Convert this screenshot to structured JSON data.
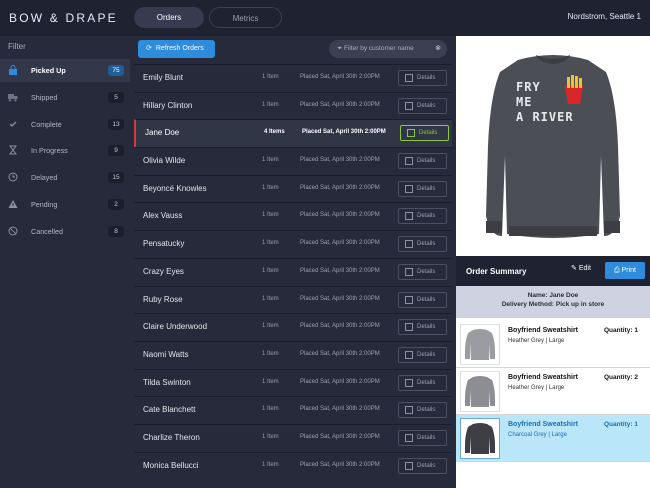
{
  "header": {
    "logo": "BOW & DRAPE",
    "tabs": [
      {
        "label": "Orders",
        "active": true
      },
      {
        "label": "Metrics",
        "active": false
      }
    ],
    "store": "Nordstrom, Seattle 1"
  },
  "sidebar": {
    "heading": "Filter",
    "items": [
      {
        "label": "Picked Up",
        "count": "75",
        "icon": "bag-icon",
        "active": true
      },
      {
        "label": "Shipped",
        "count": "5",
        "icon": "truck-icon",
        "active": false
      },
      {
        "label": "Complete",
        "count": "13",
        "icon": "check-icon",
        "active": false
      },
      {
        "label": "In Progress",
        "count": "9",
        "icon": "hourglass-icon",
        "active": false
      },
      {
        "label": "Delayed",
        "count": "15",
        "icon": "clock-icon",
        "active": false
      },
      {
        "label": "Pending",
        "count": "2",
        "icon": "warning-icon",
        "active": false
      },
      {
        "label": "Cancelled",
        "count": "8",
        "icon": "ban-icon",
        "active": false
      }
    ]
  },
  "toolbar": {
    "refresh_label": "Refresh Orders",
    "filter_placeholder": "Filter by customer name"
  },
  "orders": [
    {
      "name": "Emily Blunt",
      "items": "1 Item",
      "placed": "Placed Sat, April 30th 2:00PM",
      "details": "Details"
    },
    {
      "name": "Hillary Clinton",
      "items": "1 Item",
      "placed": "Placed Sat, April 30th 2:00PM",
      "details": "Details"
    },
    {
      "name": "Jane Doe",
      "items": "4 Items",
      "placed": "Placed Sat, April 30th 2:00PM",
      "details": "Details",
      "selected": true
    },
    {
      "name": "Olivia Wilde",
      "items": "1 Item",
      "placed": "Placed Sat, April 30th 2:00PM",
      "details": "Details"
    },
    {
      "name": "Beyoncé Knowles",
      "items": "1 Item",
      "placed": "Placed Sat, April 30th 2:00PM",
      "details": "Details"
    },
    {
      "name": "Alex Vauss",
      "items": "1 Item",
      "placed": "Placed Sat, April 30th 2:00PM",
      "details": "Details"
    },
    {
      "name": "Pensatucky",
      "items": "1 Item",
      "placed": "Placed Sat, April 30th 2:00PM",
      "details": "Details"
    },
    {
      "name": "Crazy Eyes",
      "items": "1 Item",
      "placed": "Placed Sat, April 30th 2:00PM",
      "details": "Details"
    },
    {
      "name": "Ruby Rose",
      "items": "1 Item",
      "placed": "Placed Sat, April 30th 2:00PM",
      "details": "Details"
    },
    {
      "name": "Claire Underwood",
      "items": "1 Item",
      "placed": "Placed Sat, April 30th 2:00PM",
      "details": "Details"
    },
    {
      "name": "Naomi Watts",
      "items": "1 Item",
      "placed": "Placed Sat, April 30th 2:00PM",
      "details": "Details"
    },
    {
      "name": "Tilda Swinton",
      "items": "1 Item",
      "placed": "Placed Sat, April 30th 2:00PM",
      "details": "Details"
    },
    {
      "name": "Cate Blanchett",
      "items": "1 Item",
      "placed": "Placed Sat, April 30th 2:00PM",
      "details": "Details"
    },
    {
      "name": "Charlize Theron",
      "items": "1 Item",
      "placed": "Placed Sat, April 30th 2:00PM",
      "details": "Details"
    },
    {
      "name": "Monica Bellucci",
      "items": "1 Item",
      "placed": "Placed Sat, April 30th 2:00PM",
      "details": "Details"
    }
  ],
  "product_preview": {
    "print_text": "FRY ME A RIVER"
  },
  "summary": {
    "title": "Order Summary",
    "edit_label": "Edit",
    "print_label": "Print",
    "name_line": "Name: Jane Doe",
    "delivery_line": "Delivery Method: Pick up in store",
    "items": [
      {
        "name": "Boyfriend Sweatshirt",
        "variant": "Heather Grey | Large",
        "qty": "Quantity: 1",
        "color": "#9a9ca2",
        "highlight": false
      },
      {
        "name": "Boyfriend Sweatshirt",
        "variant": "Heather Grey | Large",
        "qty": "Quantity: 2",
        "color": "#8c8e94",
        "highlight": false
      },
      {
        "name": "Boyfriend Sweatshirt",
        "variant": "Charcoal Grey | Large",
        "qty": "Quantity: 1",
        "color": "#3d3f45",
        "highlight": true
      }
    ]
  },
  "colors": {
    "accent": "#2f8bdc",
    "selected_marker": "#d63a3a",
    "details_active": "#8dc63f",
    "highlight_row": "#b9e6f8"
  }
}
